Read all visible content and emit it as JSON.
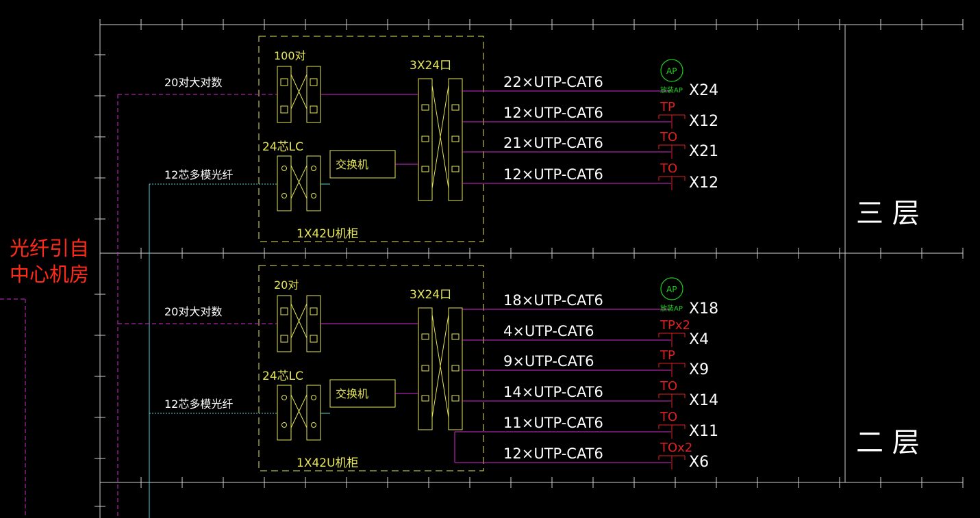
{
  "colors": {
    "background": "#000000",
    "grid": "#ffffff",
    "cabinet": "#e6e65a",
    "copper": "#d22cd2",
    "fiber": "#5ad2d2",
    "outlet": "#e02020",
    "ap": "#20d020",
    "annotation": "#ff2a1a"
  },
  "note": {
    "line1": "光纤引自",
    "line2": "中心机房"
  },
  "floors": [
    {
      "name": "三  层",
      "voice_panel": "100对",
      "voice_cable": "20对大对数",
      "fiber_panel": "24芯LC",
      "fiber_cable": "12芯多模光纤",
      "switch": "交换机",
      "patch_panel": "3X24口",
      "cabinet": "1X42U机柜",
      "runs": [
        {
          "cable": "22×UTP-CAT6",
          "outlet": "AP",
          "outlet_sub": "放装AP",
          "count": "X24"
        },
        {
          "cable": "12×UTP-CAT6",
          "outlet": "TP",
          "count": "X12"
        },
        {
          "cable": "21×UTP-CAT6",
          "outlet": "TO",
          "count": "X21"
        },
        {
          "cable": "12×UTP-CAT6",
          "outlet": "TO",
          "count": "X12"
        }
      ]
    },
    {
      "name": "二  层",
      "voice_panel": "20对",
      "voice_cable": "20对大对数",
      "fiber_panel": "24芯LC",
      "fiber_cable": "12芯多模光纤",
      "switch": "交换机",
      "patch_panel": "3X24口",
      "cabinet": "1X42U机柜",
      "runs": [
        {
          "cable": "18×UTP-CAT6",
          "outlet": "AP",
          "outlet_sub": "放装AP",
          "count": "X18"
        },
        {
          "cable": "4×UTP-CAT6",
          "outlet": "TPx2",
          "count": "X4"
        },
        {
          "cable": "9×UTP-CAT6",
          "outlet": "TP",
          "count": "X9"
        },
        {
          "cable": "14×UTP-CAT6",
          "outlet": "TO",
          "count": "X14"
        },
        {
          "cable": "11×UTP-CAT6",
          "outlet": "TO",
          "count": "X11"
        },
        {
          "cable": "12×UTP-CAT6",
          "outlet": "TOx2",
          "count": "X6"
        }
      ]
    }
  ]
}
